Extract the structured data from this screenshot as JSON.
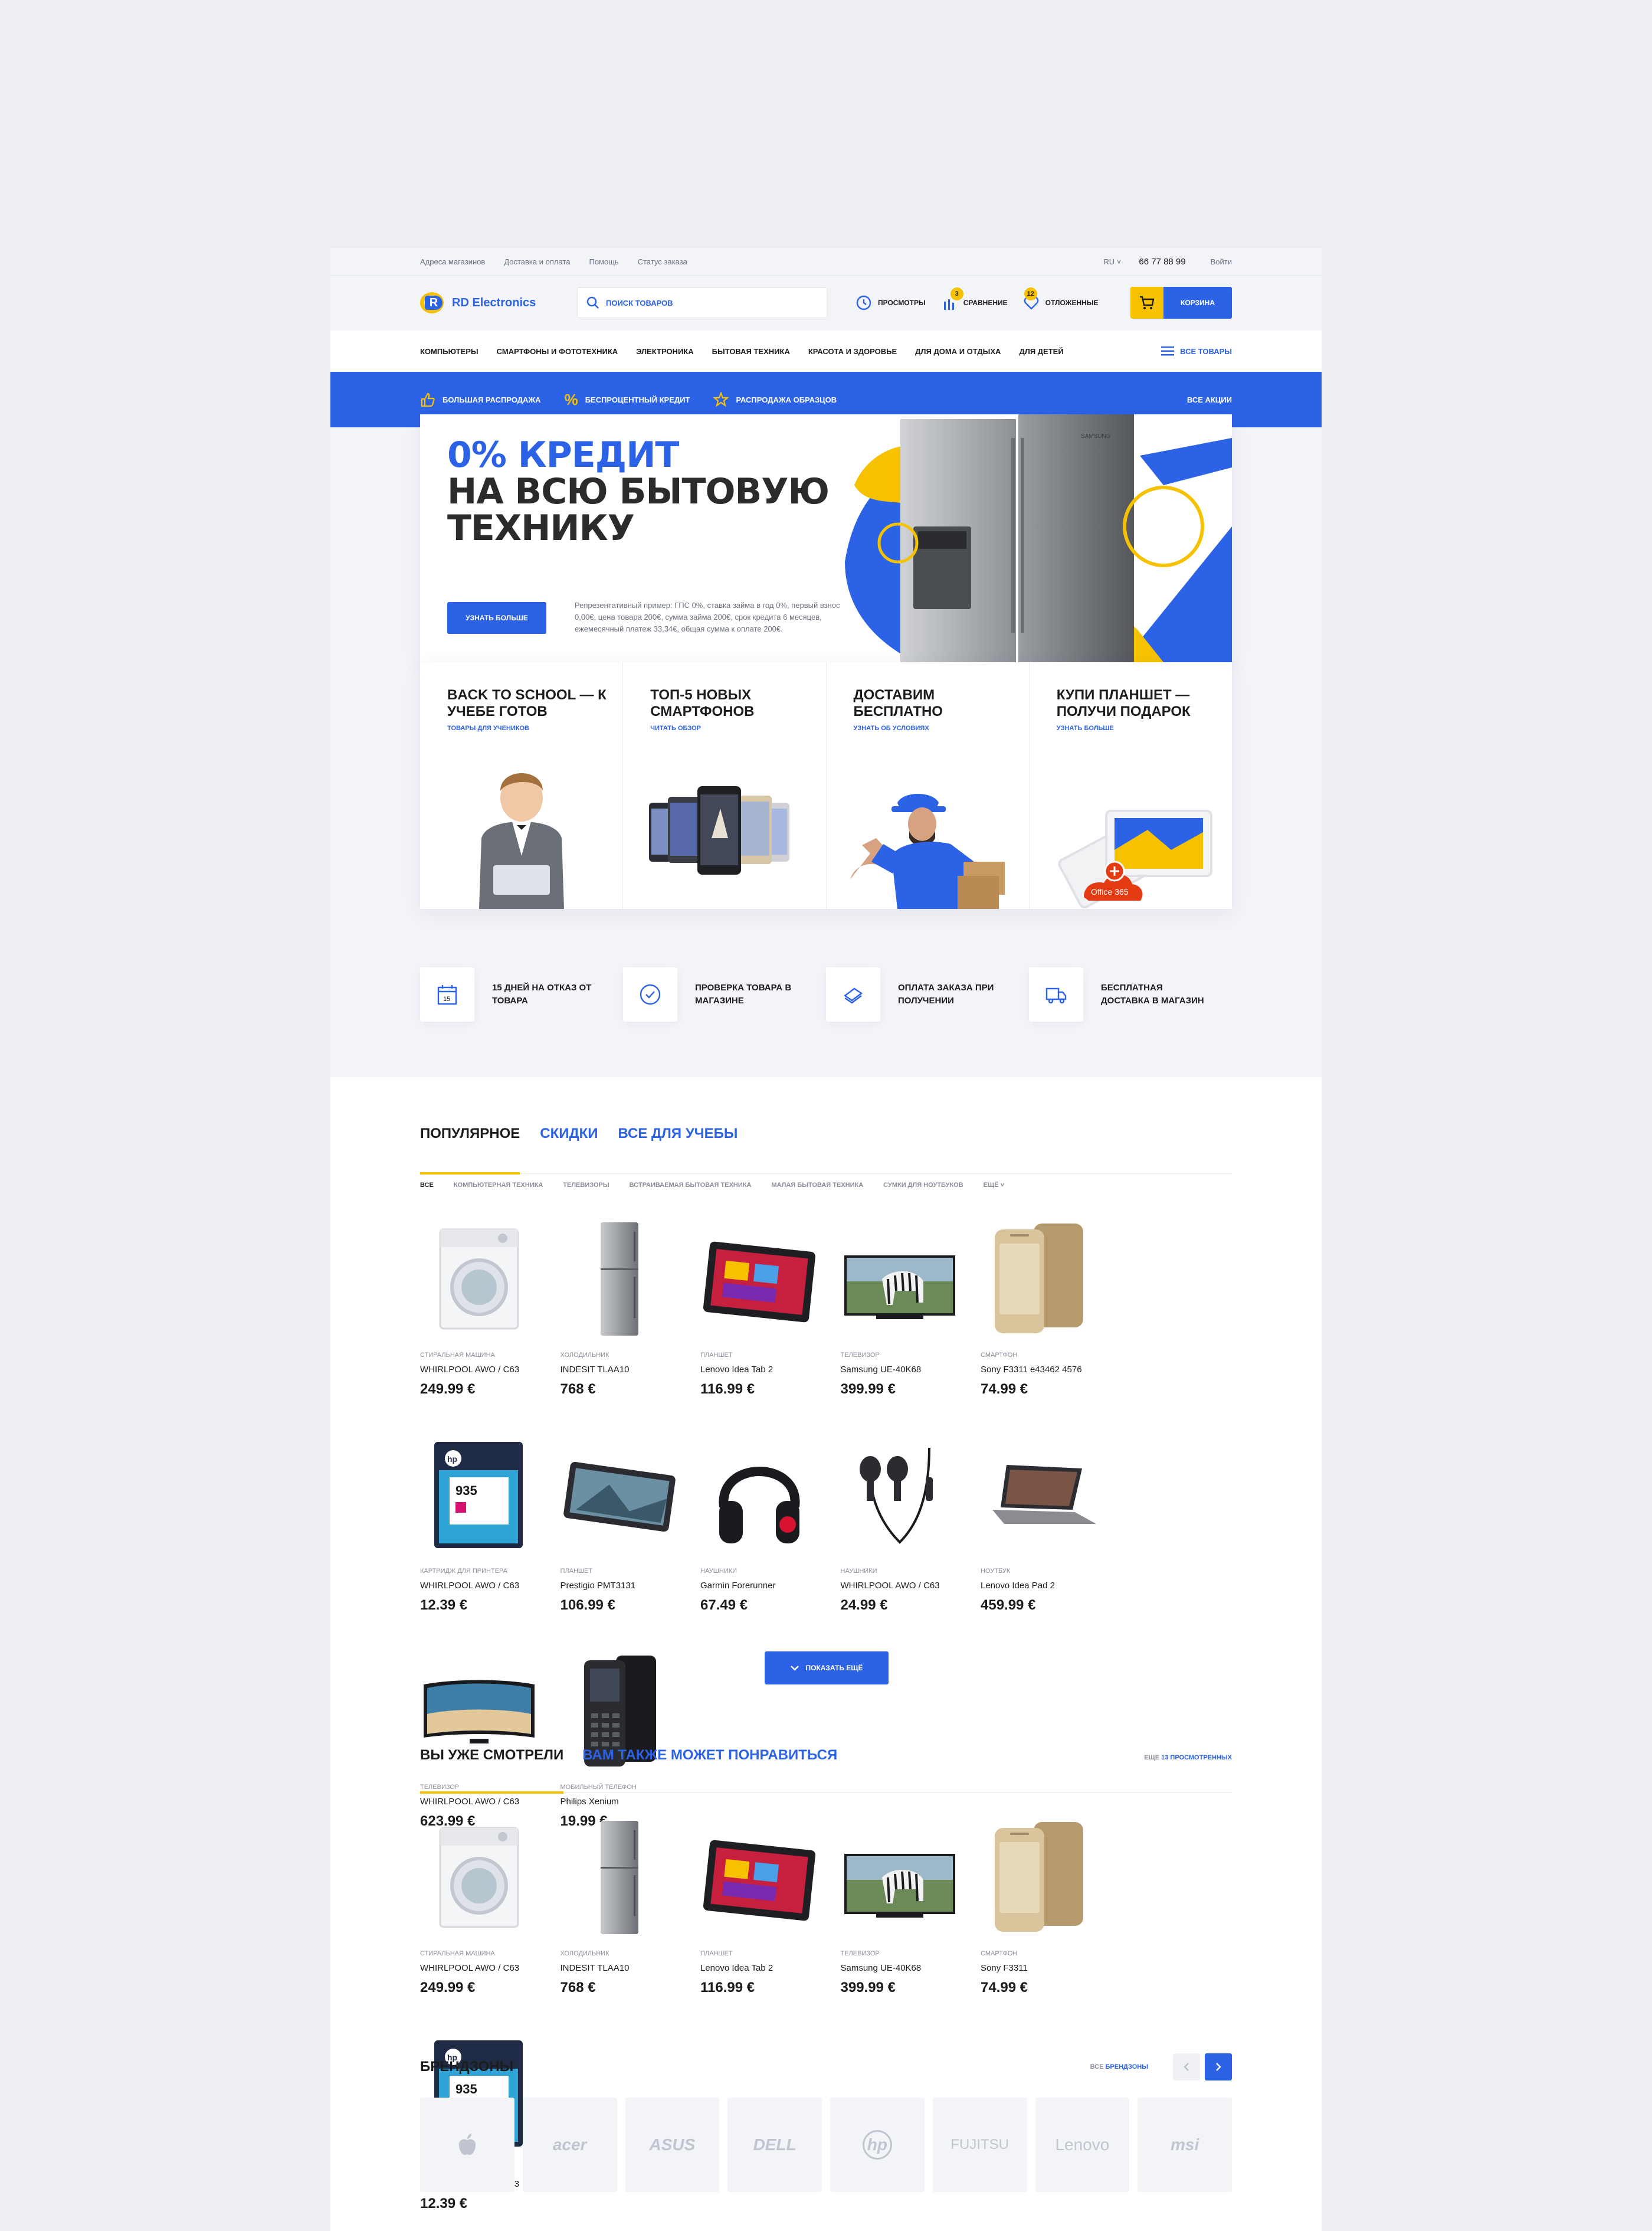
{
  "topbar": {
    "links": [
      "Адреса магазинов",
      "Доставка и оплата",
      "Помощь",
      "Статус заказа"
    ],
    "lang": "RU",
    "phone": "66 77 88 99",
    "login": "Войти"
  },
  "header": {
    "logo": "RD Electronics",
    "search_placeholder": "поиск товаров",
    "views": "просмотры",
    "compare": "сравнение",
    "compare_count": "3",
    "saved": "отложенные",
    "saved_count": "12",
    "cart": "Корзина"
  },
  "catnav": {
    "items": [
      "Компьютеры",
      "Смартфоны и фототехника",
      "Электроника",
      "Бытовая техника",
      "Красота и здоровье",
      "Для дома и отдыха",
      "Для детей"
    ],
    "all": "Все товары"
  },
  "promo": {
    "items": [
      "Большая распродажа",
      "Беспроцентный кредит",
      "Распродажа образцов"
    ],
    "all": "Все акции"
  },
  "hero": {
    "line1": "0% КРЕДИТ",
    "line2": "НА ВСЮ БЫТОВУЮ",
    "line3": "ТЕХНИКУ",
    "button": "Узнать больше",
    "fine": "Репрезентативный пример: ГПС 0%, ставка займа в год 0%, первый взнос 0,00€, цена товара 200€, сумма займа 200€, срок кредита 6 месяцев, ежемесячный платеж 33,34€, общая сумма к оплате 200€.",
    "brand": "SAMSUNG"
  },
  "tiles": [
    {
      "title": "Back to school — к учебе готов",
      "link": "Товары для учеников"
    },
    {
      "title": "Топ-5 новых смартфонов",
      "link": "Читать обзор"
    },
    {
      "title": "Доставим бесплатно",
      "link": "Узнать об условиях"
    },
    {
      "title": "Купи планшет — получи подарок",
      "link": "Узнать больше",
      "badge": "Office 365"
    }
  ],
  "benefits": [
    {
      "text": "15 дней на отказ от товара",
      "icon": "calendar-icon",
      "num": "15"
    },
    {
      "text": "Проверка товара в магазине",
      "icon": "check-icon"
    },
    {
      "text": "Оплата заказа при получении",
      "icon": "money-icon"
    },
    {
      "text": "Бесплатная доставка в магазин",
      "icon": "truck-icon"
    }
  ],
  "popular": {
    "tabs": [
      "Популярное",
      "Скидки",
      "Все для учебы"
    ],
    "filters": [
      "Все",
      "Компьютерная техника",
      "Телевизоры",
      "Встраиваемая бытовая техника",
      "Малая бытовая техника",
      "Сумки для ноутбуков",
      "Ещё"
    ],
    "products": [
      {
        "cat": "Стиральная машина",
        "name": "WHIRLPOOL AWO / C63",
        "price": "249.99 €",
        "kind": "washer"
      },
      {
        "cat": "Холодильник",
        "name": "INDESIT TLAA10",
        "price": "768 €",
        "kind": "fridge"
      },
      {
        "cat": "Планшет",
        "name": "Lenovo Idea Tab 2",
        "price": "116.99 €",
        "kind": "tablet"
      },
      {
        "cat": "Телевизор",
        "name": "Samsung UE-40K68",
        "price": "399.99 €",
        "kind": "tv"
      },
      {
        "cat": "Смартфон",
        "name": "Sony F3311 e43462 4576",
        "price": "74.99 €",
        "kind": "phone"
      },
      {
        "cat": "Картридж для принтера",
        "name": "WHIRLPOOL AWO / C63",
        "price": "12.39 €",
        "kind": "cartridge"
      },
      {
        "cat": "Планшет",
        "name": "Prestigio PMT3131",
        "price": "106.99 €",
        "kind": "tablet2"
      },
      {
        "cat": "Наушники",
        "name": "Garmin Forerunner",
        "price": "67.49 €",
        "kind": "headphones"
      },
      {
        "cat": "Наушники",
        "name": "WHIRLPOOL AWO / C63",
        "price": "24.99 €",
        "kind": "earbuds"
      },
      {
        "cat": "Ноутбук",
        "name": "Lenovo Idea Pad 2",
        "price": "459.99 €",
        "kind": "laptop"
      },
      {
        "cat": "Телевизор",
        "name": "WHIRLPOOL AWO / C63",
        "price": "623.99 €",
        "kind": "tv2"
      },
      {
        "cat": "Мобильный телефон",
        "name": "Philips Xenium",
        "price": "19.99 €",
        "kind": "mobile"
      }
    ],
    "more": "Показать ещё"
  },
  "seen": {
    "tabs": [
      "Вы уже смотрели",
      "Вам также может понравиться"
    ],
    "more_prefix": "Еще",
    "more_link": "13 просмотренных",
    "products": [
      {
        "cat": "Стиральная машина",
        "name": "WHIRLPOOL AWO / C63",
        "price": "249.99 €",
        "kind": "washer"
      },
      {
        "cat": "Холодильник",
        "name": "INDESIT TLAA10",
        "price": "768 €",
        "kind": "fridge"
      },
      {
        "cat": "Планшет",
        "name": "Lenovo Idea Tab 2",
        "price": "116.99 €",
        "kind": "tablet"
      },
      {
        "cat": "Телевизор",
        "name": "Samsung UE-40K68",
        "price": "399.99 €",
        "kind": "tv"
      },
      {
        "cat": "Смартфон",
        "name": "Sony F3311",
        "price": "74.99 €",
        "kind": "phone"
      },
      {
        "cat": "Картридж для принтера",
        "name": "WHIRLPOOL AWO / C63",
        "price": "12.39 €",
        "kind": "cartridge"
      }
    ]
  },
  "brands": {
    "title": "Брендзоны",
    "all_prefix": "Все",
    "all_link": "брендзоны",
    "items": [
      "",
      "acer",
      "ASUS",
      "DELL",
      "hp",
      "FUJITSU",
      "Lenovo",
      "msi"
    ]
  },
  "colors": {
    "accent": "#2c62e6",
    "yellow": "#f6c200"
  }
}
